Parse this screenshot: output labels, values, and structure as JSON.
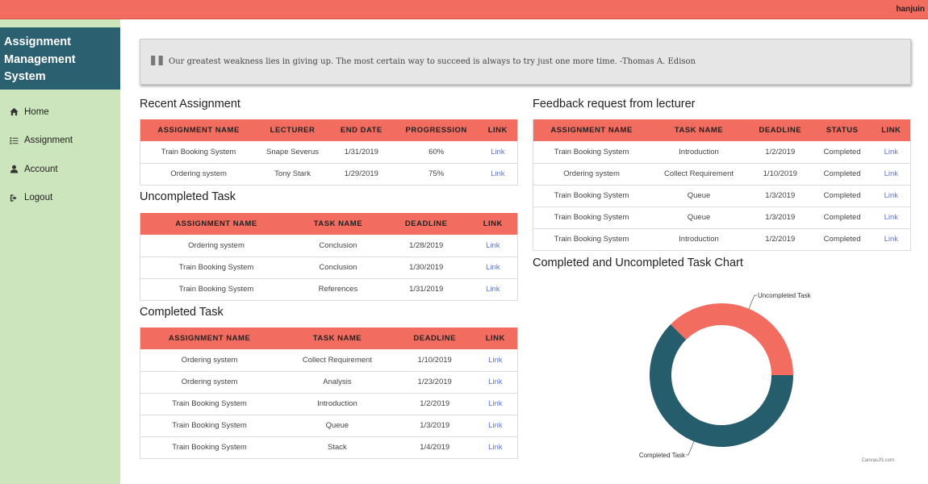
{
  "topbar": {
    "username": "hanjuin"
  },
  "sidebar": {
    "brand": "Assignment Management System",
    "items": [
      {
        "label": "Home",
        "icon": "home-icon"
      },
      {
        "label": "Assignment",
        "icon": "list-icon"
      },
      {
        "label": "Account",
        "icon": "user-icon"
      },
      {
        "label": "Logout",
        "icon": "logout-icon"
      }
    ]
  },
  "quote": {
    "text": "Our greatest weakness lies in giving up. The most certain way to succeed is always to try just one more time. -Thomas A. Edison"
  },
  "recent": {
    "title": "Recent Assignment",
    "headers": [
      "ASSIGNMENT NAME",
      "LECTURER",
      "END DATE",
      "PROGRESSION",
      "LINK"
    ],
    "rows": [
      {
        "name": "Train Booking System",
        "lecturer": "Snape Severus",
        "end_date": "1/31/2019",
        "progression": "60%",
        "link": "Link"
      },
      {
        "name": "Ordering system",
        "lecturer": "Tony Stark",
        "end_date": "1/29/2019",
        "progression": "75%",
        "link": "Link"
      }
    ]
  },
  "uncompleted": {
    "title": "Uncompleted Task",
    "headers": [
      "ASSIGNMENT NAME",
      "TASK NAME",
      "DEADLINE",
      "LINK"
    ],
    "rows": [
      {
        "name": "Ordering system",
        "task": "Conclusion",
        "deadline": "1/28/2019",
        "link": "Link"
      },
      {
        "name": "Train Booking System",
        "task": "Conclusion",
        "deadline": "1/30/2019",
        "link": "Link"
      },
      {
        "name": "Train Booking System",
        "task": "References",
        "deadline": "1/31/2019",
        "link": "Link"
      }
    ]
  },
  "completed": {
    "title": "Completed Task",
    "headers": [
      "ASSIGNMENT NAME",
      "TASK NAME",
      "DEADLINE",
      "LINK"
    ],
    "rows": [
      {
        "name": "Ordering system",
        "task": "Collect Requirement",
        "deadline": "1/10/2019",
        "link": "Link"
      },
      {
        "name": "Ordering system",
        "task": "Analysis",
        "deadline": "1/23/2019",
        "link": "Link"
      },
      {
        "name": "Train Booking System",
        "task": "Introduction",
        "deadline": "1/2/2019",
        "link": "Link"
      },
      {
        "name": "Train Booking System",
        "task": "Queue",
        "deadline": "1/3/2019",
        "link": "Link"
      },
      {
        "name": "Train Booking System",
        "task": "Stack",
        "deadline": "1/4/2019",
        "link": "Link"
      }
    ]
  },
  "feedback": {
    "title": "Feedback request from lecturer",
    "headers": [
      "ASSIGNMENT NAME",
      "TASK NAME",
      "DEADLINE",
      "STATUS",
      "LINK"
    ],
    "rows": [
      {
        "name": "Train Booking System",
        "task": "Introduction",
        "deadline": "1/2/2019",
        "status": "Completed",
        "link": "Link"
      },
      {
        "name": "Ordering system",
        "task": "Collect Requirement",
        "deadline": "1/10/2019",
        "status": "Completed",
        "link": "Link"
      },
      {
        "name": "Train Booking System",
        "task": "Queue",
        "deadline": "1/3/2019",
        "status": "Completed",
        "link": "Link"
      },
      {
        "name": "Train Booking System",
        "task": "Queue",
        "deadline": "1/3/2019",
        "status": "Completed",
        "link": "Link"
      },
      {
        "name": "Train Booking System",
        "task": "Introduction",
        "deadline": "1/2/2019",
        "status": "Completed",
        "link": "Link"
      }
    ]
  },
  "chart_section": {
    "title": "Completed and Uncompleted Task Chart",
    "credit": "CanvasJS.com"
  },
  "chart_data": {
    "type": "pie",
    "donut": true,
    "categories": [
      "Uncompleted Task",
      "Completed Task"
    ],
    "values": [
      37.5,
      62.5
    ],
    "colors": [
      "#f26d5f",
      "#255d6c"
    ],
    "title": "",
    "legend": "none"
  },
  "colors": {
    "accent": "#f26d5f",
    "brand": "#2a6070",
    "sidebar": "#cde5bd",
    "link": "#5b75d9"
  }
}
